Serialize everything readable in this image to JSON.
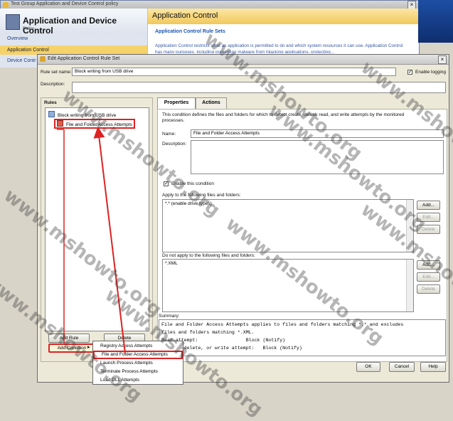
{
  "background_window": {
    "title": "Test Group Application and Device Control policy",
    "heading": "Application and Device Control",
    "subheading": "Policy",
    "nav": [
      "Overview",
      "Application Control",
      "Device Contr"
    ],
    "right_banner": "Application Control",
    "section_title": "Application Control Rule Sets",
    "description": "Application Control restricts what an application is permitted to do and which system resources it can use. Application Control has many purposes, including preventing malware from hijacking applications, protecting..."
  },
  "dialog": {
    "title": "Edit Application Control Rule Set",
    "rule_set_name_label": "Rule set name:",
    "rule_set_name_value": "Block writing from USB drive",
    "enable_logging_label": "Enable logging",
    "description_label": "Description:",
    "rules_label": "Rules",
    "rules_tree": [
      {
        "label": "Block writing from USB drive"
      },
      {
        "label": "File and Folder Access Attempts"
      }
    ],
    "add_rule_button": "Add Rule",
    "delete_button": "Delete",
    "add_condition_button": "Add Condition",
    "tabs": [
      "Properties",
      "Actions"
    ],
    "condition_text": "This condition defines the files and folders for which to detect create, delete, read, and write attempts by the monitored processes.",
    "name_label": "Name:",
    "name_value": "File and Folder Access Attempts",
    "desc_label": "Description:",
    "enable_condition_label": "Enable this condition",
    "apply_label": "Apply to the following files and folders:",
    "apply_items": [
      "*.* (enable drive types)"
    ],
    "not_apply_label": "Do not apply to the following files and folders:",
    "not_apply_items": [
      "*.XML"
    ],
    "add_btn": "Add...",
    "edit_btn": "Edit...",
    "delete_btn": "Delete",
    "summary_label": "Summary:",
    "summary_lines": [
      "File and Folder Access Attempts applies to files and folders matching *.* and excludes",
      "files and folders matching *.XML.",
      "Read attempt:                 Block (Notify)",
      "Create, delete, or write attempt:   Block (Notify)"
    ],
    "ok_button": "OK",
    "cancel_button": "Cancel",
    "help_button": "Help"
  },
  "context_menu": {
    "items": [
      "Registry Access Attempts",
      "File and Folder Access Attempts",
      "Launch Process Attempts",
      "Terminate Process Attempts",
      "Load DLL Attempts"
    ]
  },
  "watermark": "www.mshowto.org",
  "colors": {
    "highlight_red": "#dd2222",
    "dialog_bg": "#ece9d8",
    "banner_yellow": "#f1c85b",
    "link_blue": "#1b55b5"
  }
}
